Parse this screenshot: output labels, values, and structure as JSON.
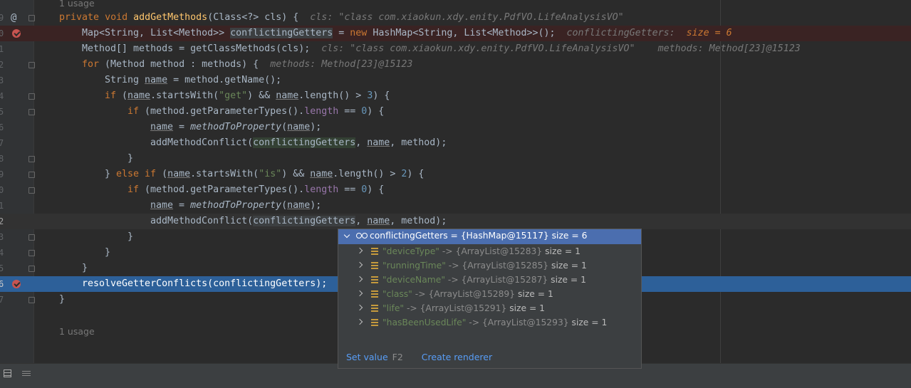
{
  "usage_top": "1 usage",
  "usage_bottom": "1 usage",
  "line_numbers": [
    "9",
    "0",
    "1",
    "2",
    "3",
    "4",
    "5",
    "6",
    "7",
    "8",
    "9",
    "0",
    "1",
    "2",
    "3",
    "4",
    "5",
    "6",
    "7"
  ],
  "code": {
    "l0": {
      "private": "private",
      "void": "void",
      "name": "addGetMethods",
      "sig": "(Class<?> cls) {",
      "hint": "cls: \"class com.xiaokun.xdy.enity.PdfVO.LifeAnalysisVO\""
    },
    "l1": {
      "pre": "Map<String, List<Method>> ",
      "var": "conflictingGetters",
      "mid": " = ",
      "new": "new",
      "post": " HashMap<String, List<Method>>();",
      "hint_label": "conflictingGetters:",
      "hint_val": "size = 6"
    },
    "l2": {
      "text": "Method[] methods = getClassMethods(cls);",
      "hint1": "cls: \"class com.xiaokun.xdy.enity.PdfVO.LifeAnalysisVO\"",
      "hint2": "methods: Method[23]@15123"
    },
    "l3": {
      "for": "for",
      "text": " (Method method : methods) {",
      "hint": "methods: Method[23]@15123"
    },
    "l4": {
      "pre": "String ",
      "name": "name",
      "post": " = method.getName();"
    },
    "l5": {
      "if": "if",
      "a": " (",
      "name": "name",
      ".startsWith(": ".startsWith(",
      "str": "\"get\"",
      "b": ") && ",
      "name2": "name",
      "c": ".length() > ",
      "num": "3",
      "d": ") {"
    },
    "l6": {
      "if": "if",
      "a": " (method.getParameterTypes().",
      "len": "length",
      "b": " == ",
      "num": "0",
      "c": ") {"
    },
    "l7": {
      "name": "name",
      "eq": " = ",
      "fn": "methodToProperty",
      "a": "(",
      "arg": "name",
      "b": ");"
    },
    "l8": {
      "a": "addMethodConflict(",
      "var": "conflictingGetters",
      "b": ", ",
      "name": "name",
      "c": ", method);"
    },
    "l9": {
      "text": "}"
    },
    "l10": {
      "a": "} ",
      "else": "else if",
      "b": " (",
      "name": "name",
      "c": ".startsWith(",
      "str": "\"is\"",
      "d": ") && ",
      "name2": "name",
      "e": ".length() > ",
      "num": "2",
      "f": ") {"
    },
    "l11": {
      "if": "if",
      "a": " (method.getParameterTypes().",
      "len": "length",
      "b": " == ",
      "num": "0",
      "c": ") {"
    },
    "l12": {
      "name": "name",
      "eq": " = ",
      "fn": "methodToProperty",
      "a": "(",
      "arg": "name",
      "b": ");"
    },
    "l13": {
      "a": "addMethodConflict(",
      "var": "conflictingGetters",
      "b": ", ",
      "name": "name",
      "c": ", method);"
    },
    "l14": {
      "text": "}"
    },
    "l15": {
      "text": "}"
    },
    "l16": {
      "text": "}"
    },
    "l17": {
      "text": "resolveGetterConflicts(conflictingGetters);"
    },
    "l18": {
      "text": "}"
    }
  },
  "popup": {
    "header_name": "conflictingGetters",
    "header_value": " = {HashMap@15117}  size = 6",
    "entries": [
      {
        "key": "\"deviceType\"",
        "ref": " -> {ArrayList@15283}",
        "size": "size = 1"
      },
      {
        "key": "\"runningTime\"",
        "ref": " -> {ArrayList@15285}",
        "size": "size = 1"
      },
      {
        "key": "\"deviceName\"",
        "ref": " -> {ArrayList@15287}",
        "size": "size = 1"
      },
      {
        "key": "\"class\"",
        "ref": " -> {ArrayList@15289}",
        "size": "size = 1"
      },
      {
        "key": "\"life\"",
        "ref": " -> {ArrayList@15291}",
        "size": "size = 1"
      },
      {
        "key": "\"hasBeenUsedLife\"",
        "ref": " -> {ArrayList@15293}",
        "size": "size = 1"
      }
    ],
    "set_value": "Set value",
    "set_value_key": "F2",
    "create_renderer": "Create renderer"
  },
  "colors": {
    "accent": "#4b6eaf",
    "current_line": "#2d6099",
    "breakpoint": "#c75450"
  }
}
